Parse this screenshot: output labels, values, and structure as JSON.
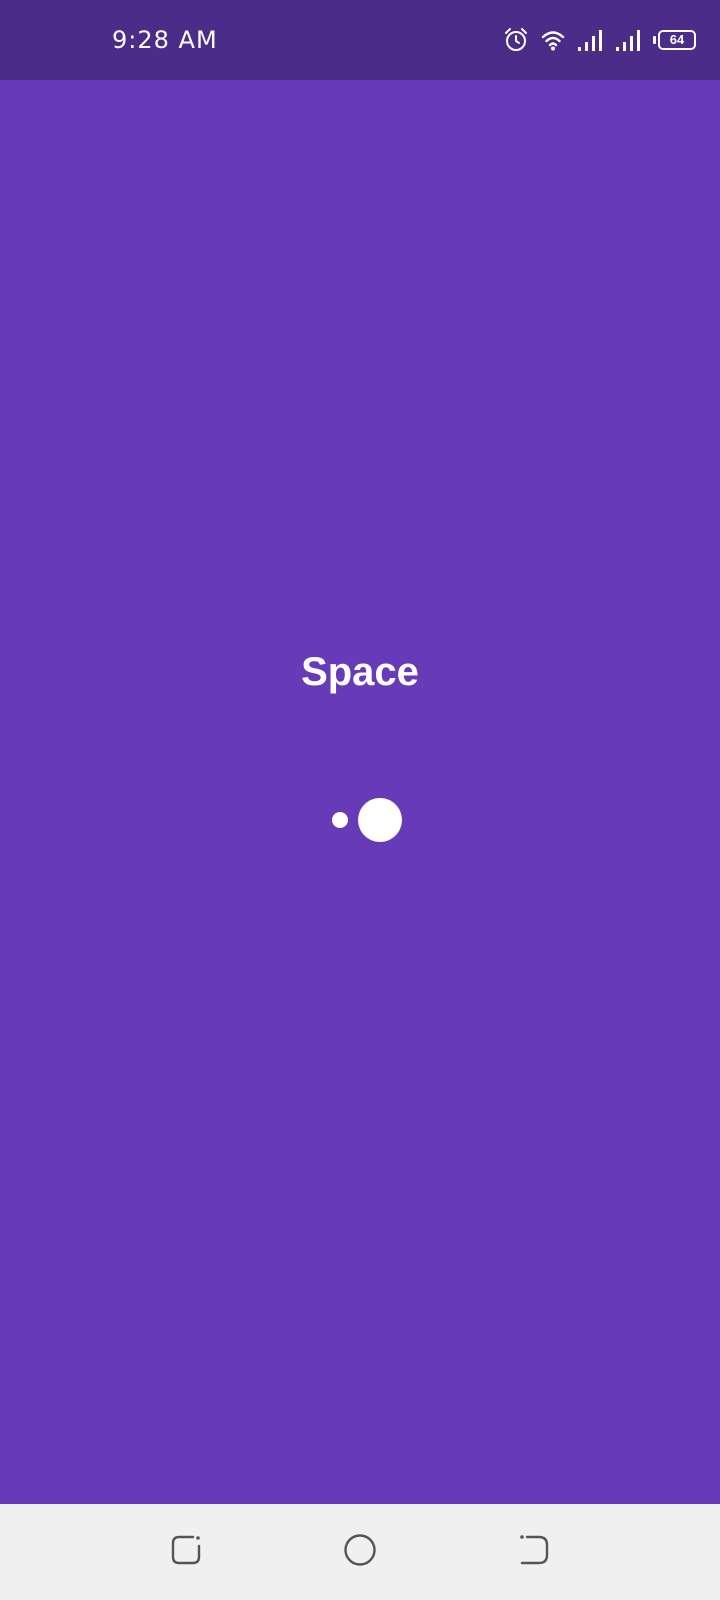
{
  "status_bar": {
    "time": "9:28 AM",
    "battery_level": "64",
    "icons": [
      "alarm-icon",
      "wifi-icon",
      "signal-icon",
      "signal-icon",
      "battery-icon"
    ]
  },
  "splash": {
    "title": "Space"
  },
  "loader": {
    "dots": 2
  },
  "nav_bar": {
    "buttons": [
      "recent-apps",
      "home",
      "back"
    ]
  },
  "colors": {
    "background": "#673AB7",
    "status_bar": "#4B2C89",
    "nav_bar": "#F0F0F0",
    "foreground": "#FFFFFF"
  }
}
